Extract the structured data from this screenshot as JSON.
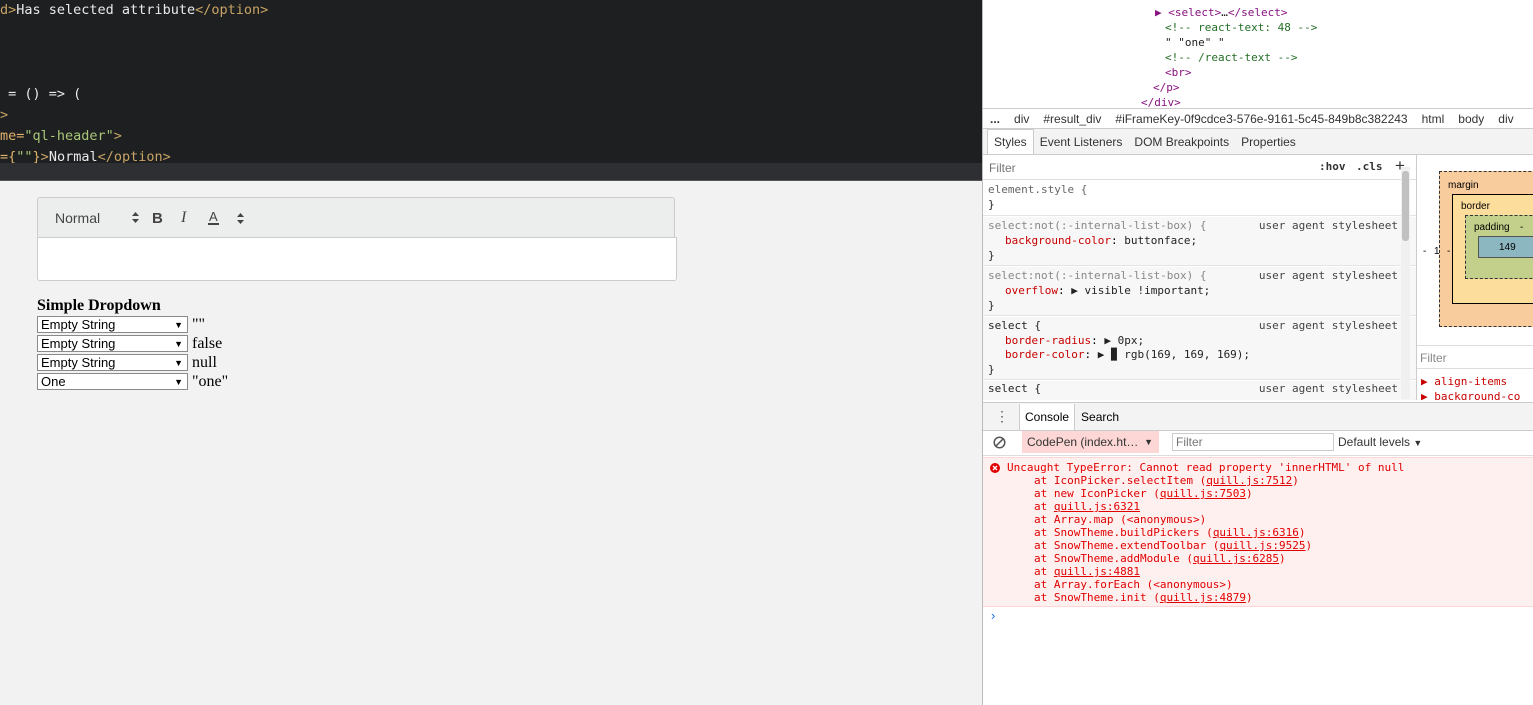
{
  "editor": {
    "lines": [
      {
        "parts": [
          {
            "c": "tag",
            "t": "d>"
          },
          {
            "c": "txt",
            "t": "Has selected attribute"
          },
          {
            "c": "tag",
            "t": "</option>"
          }
        ]
      },
      {
        "parts": [
          {
            "c": "txt",
            "t": " = () => ("
          }
        ]
      },
      {
        "parts": [
          {
            "c": "tag",
            "t": ">"
          }
        ]
      },
      {
        "parts": [
          {
            "c": "attr",
            "t": "me="
          },
          {
            "c": "str",
            "t": "\"ql-header\""
          },
          {
            "c": "tag",
            "t": ">"
          }
        ]
      },
      {
        "parts": [
          {
            "c": "attr",
            "t": "={"
          },
          {
            "c": "str",
            "t": "\"\""
          },
          {
            "c": "attr",
            "t": "}"
          },
          {
            "c": "tag",
            "t": ">"
          },
          {
            "c": "txt",
            "t": "Normal"
          },
          {
            "c": "tag",
            "t": "</option>"
          }
        ]
      }
    ]
  },
  "preview": {
    "quill": {
      "header_picker": "Normal",
      "bold": "B",
      "italic": "I",
      "color": "A"
    },
    "simple_dropdown": {
      "title": "Simple Dropdown",
      "rows": [
        {
          "selected": "Empty String",
          "value": "\"\""
        },
        {
          "selected": "Empty String",
          "value": "false"
        },
        {
          "selected": "Empty String",
          "value": "null"
        },
        {
          "selected": "One",
          "value": "\"one\""
        }
      ]
    }
  },
  "devtools": {
    "dom_tree": [
      {
        "parts": [
          {
            "c": "dtag",
            "t": "▶ <select>"
          },
          {
            "c": "dtext",
            "t": "…"
          },
          {
            "c": "dtag",
            "t": "</select>"
          }
        ]
      },
      {
        "parts": [
          {
            "c": "dcom",
            "t": "<!-- react-text: 48 -->"
          }
        ]
      },
      {
        "parts": [
          {
            "c": "dtext",
            "t": "\" \"one\" \""
          }
        ]
      },
      {
        "parts": [
          {
            "c": "dcom",
            "t": "<!-- /react-text -->"
          }
        ]
      },
      {
        "parts": [
          {
            "c": "dtag",
            "t": "<br>"
          }
        ]
      },
      {
        "parts": [
          {
            "c": "dtag",
            "t": "</p>"
          }
        ]
      },
      {
        "parts": [
          {
            "c": "dtag",
            "t": "</div>"
          }
        ]
      }
    ],
    "breadcrumbs": [
      "...",
      "div",
      "#result_div",
      "#iFrameKey-0f9cdce3-576e-9161-5c45-849b8c382243",
      "html",
      "body",
      "div"
    ],
    "styles_tabs": [
      "Styles",
      "Event Listeners",
      "DOM Breakpoints",
      "Properties"
    ],
    "styles_filter_placeholder": "Filter",
    "hov": ":hov",
    "cls": ".cls",
    "add": "+",
    "rules": [
      {
        "selector": "element.style {",
        "source": "",
        "props": [],
        "close": "}"
      },
      {
        "selector": "select:not(:-internal-list-box) {",
        "source": "user agent stylesheet",
        "props": [
          {
            "name": "background-color",
            "value": "buttonface;"
          }
        ],
        "close": "}"
      },
      {
        "selector": "select:not(:-internal-list-box) {",
        "source": "user agent stylesheet",
        "props": [
          {
            "name": "overflow",
            "value": "▶ visible !important;"
          }
        ],
        "close": "}"
      },
      {
        "selector": "select {",
        "source": "user agent stylesheet",
        "props": [
          {
            "name": "border-radius",
            "value": "▶ 0px;"
          },
          {
            "name": "border-color",
            "value": "▶ ▉ rgb(169, 169, 169);"
          }
        ],
        "close": "}"
      },
      {
        "selector": "select {",
        "source": "user agent stylesheet",
        "props": [],
        "close": ""
      }
    ],
    "box_model": {
      "margin": "margin",
      "border": "border",
      "padding": "padding",
      "left_value": "1",
      "dash": "-",
      "content": "149",
      "filter": "Filter",
      "props": [
        "align-items",
        "background-co"
      ]
    },
    "console_tabs": [
      "Console",
      "Search"
    ],
    "console_context": "CodePen (index.ht…",
    "console_filter_placeholder": "Filter",
    "console_levels": "Default levels",
    "error": {
      "message": "Uncaught TypeError: Cannot read property 'innerHTML' of null",
      "stack": [
        {
          "pre": "at IconPicker.selectItem (",
          "link": "quill.js:7512",
          "post": ")"
        },
        {
          "pre": "at new IconPicker (",
          "link": "quill.js:7503",
          "post": ")"
        },
        {
          "pre": "at ",
          "link": "quill.js:6321",
          "post": ""
        },
        {
          "pre": "at Array.map (<anonymous>)",
          "link": "",
          "post": ""
        },
        {
          "pre": "at SnowTheme.buildPickers (",
          "link": "quill.js:6316",
          "post": ")"
        },
        {
          "pre": "at SnowTheme.extendToolbar (",
          "link": "quill.js:9525",
          "post": ")"
        },
        {
          "pre": "at SnowTheme.addModule (",
          "link": "quill.js:6285",
          "post": ")"
        },
        {
          "pre": "at ",
          "link": "quill.js:4881",
          "post": ""
        },
        {
          "pre": "at Array.forEach (<anonymous>)",
          "link": "",
          "post": ""
        },
        {
          "pre": "at SnowTheme.init (",
          "link": "quill.js:4879",
          "post": ")"
        }
      ]
    },
    "prompt": "›"
  }
}
